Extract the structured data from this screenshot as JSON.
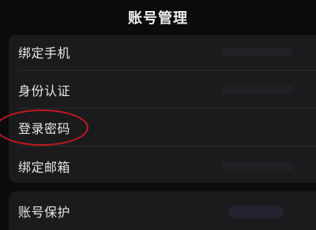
{
  "header": {
    "title": "账号管理"
  },
  "account_settings": {
    "items": [
      {
        "label": "绑定手机"
      },
      {
        "label": "身份认证"
      },
      {
        "label": "登录密码"
      },
      {
        "label": "绑定邮箱"
      }
    ]
  },
  "security": {
    "items": [
      {
        "label": "账号保护"
      }
    ]
  },
  "annotation": {
    "highlight_color": "#c41a1f",
    "highlighted_item": "登录密码"
  }
}
